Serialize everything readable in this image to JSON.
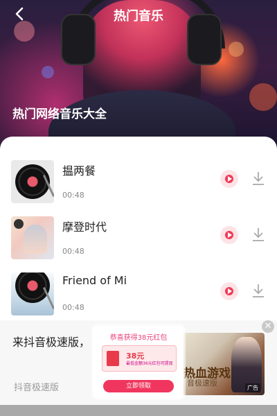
{
  "header": {
    "title": "热门音乐",
    "subtitle": "热门网络音乐大全"
  },
  "songs": [
    {
      "name": "揾两餐",
      "duration": "00:48",
      "cover_icon": "vinyl-record-icon"
    },
    {
      "name": "摩登时代",
      "duration": "00:48",
      "cover_icon": "anime-art-icon"
    },
    {
      "name": "Friend of Mi",
      "duration": "00:48",
      "cover_icon": "vinyl-record-icon"
    }
  ],
  "ad": {
    "title": "来抖音极速版，",
    "brand": "抖音极速版",
    "close_glyph": "✕",
    "popup": {
      "title": "恭喜获得38元红包",
      "amount": "38元",
      "desc": "最低金额36元红包可提现",
      "button": "立即领取"
    },
    "game": {
      "title": "热血游戏",
      "subtitle": "音极速版",
      "tag": "广告"
    }
  },
  "colors": {
    "accent": "#f03a57",
    "play_bg": "#fde3e6",
    "text_primary": "#222222",
    "text_secondary": "#888888"
  }
}
